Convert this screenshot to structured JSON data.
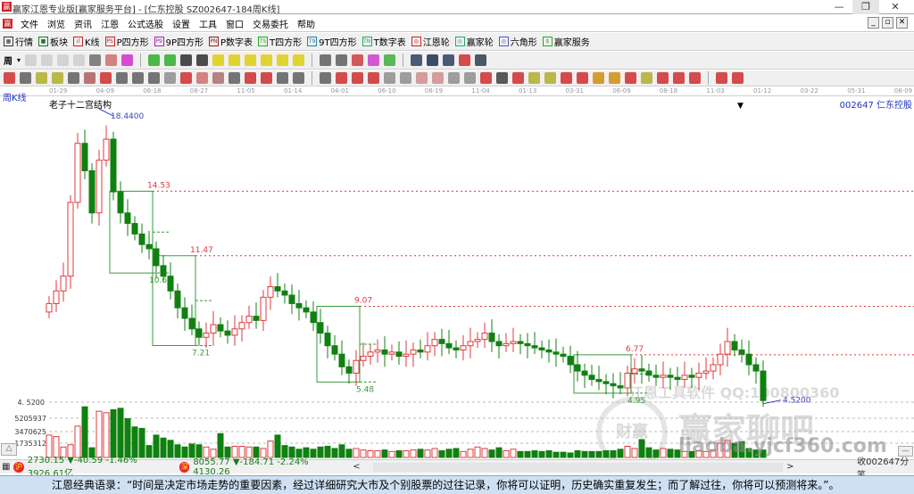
{
  "window": {
    "title": "赢家江恩专业版[赢家服务平台] - [仁东控股  SZ002647-184周K线]",
    "minimize": "—",
    "restore": "❐",
    "close": "✕",
    "logo": "赢"
  },
  "menu": {
    "items": [
      "文件",
      "浏览",
      "资讯",
      "江恩",
      "公式选股",
      "设置",
      "工具",
      "窗口",
      "交易委托",
      "帮助"
    ],
    "mdi_min": "_",
    "mdi_restore": "▫",
    "mdi_close": "✕"
  },
  "toolbar1": [
    {
      "label": "行情",
      "icon": "grid-icon",
      "glyph": "▦",
      "color": "#333"
    },
    {
      "label": "板块",
      "icon": "blocks-icon",
      "glyph": "■",
      "color": "#1a7a2a"
    },
    {
      "label": "K线",
      "icon": "kline-icon",
      "glyph": "ıl",
      "color": "#c22"
    },
    {
      "label": "P四方形",
      "icon": "p-square-icon",
      "glyph": "PS",
      "color": "#c22"
    },
    {
      "label": "9P四方形",
      "icon": "9p-square-icon",
      "glyph": "P9",
      "color": "#a2a"
    },
    {
      "label": "P数字表",
      "icon": "p-table-icon",
      "glyph": "PN",
      "color": "#822"
    },
    {
      "label": "T四方形",
      "icon": "t-square-icon",
      "glyph": "TS",
      "color": "#2a2"
    },
    {
      "label": "9T四方形",
      "icon": "9t-square-icon",
      "glyph": "T9",
      "color": "#28a"
    },
    {
      "label": "T数字表",
      "icon": "t-table-icon",
      "glyph": "TN",
      "color": "#2a6"
    },
    {
      "label": "江恩轮",
      "icon": "gann-wheel-icon",
      "glyph": "◎",
      "color": "#c22"
    },
    {
      "label": "赢家轮",
      "icon": "winner-wheel-icon",
      "glyph": "◎",
      "color": "#2a6"
    },
    {
      "label": "六角形",
      "icon": "hexagon-icon",
      "glyph": "◎",
      "color": "#55c"
    },
    {
      "label": "赢家服务",
      "icon": "dollar-icon",
      "glyph": "$",
      "color": "#2a2"
    }
  ],
  "period_selector": "周",
  "toolbar2_icons": [
    [
      "grid-ghost-icon",
      "#ccc"
    ],
    [
      "doc-ghost-icon",
      "#ccc"
    ],
    [
      "chart-ghost-icon",
      "#ccc"
    ],
    [
      "chart2-ghost-icon",
      "#ccc"
    ],
    [
      "candle-type-icon",
      "#666"
    ],
    [
      "overlay-icon",
      "#c66"
    ],
    [
      "color-flag-icon",
      "#c2c"
    ],
    "|",
    [
      "first-icon",
      "#2a2"
    ],
    [
      "last-icon",
      "#2a2"
    ],
    [
      "prev-icon",
      "#222"
    ],
    [
      "next-icon",
      "#222"
    ],
    [
      "diamond-up-icon",
      "#dc0"
    ],
    [
      "diamond-down-icon",
      "#dc0"
    ],
    [
      "diamond-left-icon",
      "#dc0"
    ],
    [
      "diamond-right-icon",
      "#dc0"
    ],
    [
      "diamond-in-icon",
      "#dc0"
    ],
    [
      "diamond-out-icon",
      "#dc0"
    ],
    "|",
    [
      "hand-icon",
      "#555"
    ],
    [
      "crosshair-icon",
      "#555"
    ],
    [
      "line-tool-icon",
      "#c33"
    ],
    [
      "gift-icon",
      "#c3c"
    ],
    [
      "calc-icon",
      "#3a3"
    ],
    "|",
    [
      "calendar-icon",
      "#235"
    ],
    [
      "calculator-icon",
      "#124"
    ],
    [
      "notes-icon",
      "#235"
    ],
    [
      "save-icon",
      "#c22"
    ],
    [
      "network-icon",
      "#234"
    ]
  ],
  "toolbar3_icons": [
    [
      "pen-icon",
      "#c22"
    ],
    [
      "parallel-icon",
      "#555"
    ],
    [
      "gann-fan-icon",
      "#aa2"
    ],
    [
      "gann-fan2-icon",
      "#aa2"
    ],
    [
      "gann-grid-icon",
      "#555"
    ],
    [
      "gann-box-icon",
      "#a55"
    ],
    [
      "pencil-red-icon",
      "#c22"
    ],
    [
      "circle-icon",
      "#555"
    ],
    [
      "lines-icon",
      "#555"
    ],
    [
      "n2-icon",
      "#555"
    ],
    [
      "pitchfork-icon",
      "#888"
    ],
    [
      "target-icon",
      "#c22"
    ],
    [
      "star-icon",
      "#c66"
    ],
    [
      "square-icon",
      "#a66"
    ],
    [
      "arc-icon",
      "#555"
    ],
    [
      "red-lines-icon",
      "#c22"
    ],
    [
      "red-box-icon",
      "#c22"
    ],
    [
      "grid2-icon",
      "#555"
    ],
    [
      "measure-icon",
      "#555"
    ],
    "|",
    [
      "rect-icon",
      "#555"
    ],
    [
      "fib-fan-icon",
      "#c22"
    ],
    [
      "fib-box-icon",
      "#c22"
    ],
    [
      "fib-box2-icon",
      "#c22"
    ],
    [
      "angle-icon",
      "#888"
    ],
    [
      "wave-icon",
      "#888"
    ],
    [
      "table-icon",
      "#c88"
    ],
    [
      "table2-icon",
      "#c88"
    ],
    [
      "lines3-icon",
      "#888"
    ],
    [
      "e-icon",
      "#888"
    ],
    [
      "fib-pct-icon",
      "#c22"
    ],
    [
      "percent-icon",
      "#333"
    ],
    [
      "pct-lines-icon",
      "#c22"
    ],
    [
      "gold-coin-icon",
      "#aa2"
    ],
    [
      "gold-lines-icon",
      "#aa2"
    ],
    [
      "flag-icon",
      "#c22"
    ],
    [
      "fib-icon",
      "#c22"
    ],
    [
      "gold-icon",
      "#c80"
    ],
    [
      "angle2-icon",
      "#c80"
    ],
    [
      "f-angle-icon",
      "#c22"
    ],
    [
      "angle3-icon",
      "#aa2"
    ],
    [
      "angle4-icon",
      "#c22"
    ],
    [
      "angle5-icon",
      "#c22"
    ],
    [
      "angle6-icon",
      "#c22"
    ],
    "|",
    [
      "yin-yang-icon",
      "#c22"
    ],
    [
      "infinity-icon",
      "#c22"
    ]
  ],
  "chart": {
    "period_label": "周K线",
    "template_name": "老子十二宫结构",
    "stock": "002647  仁东控股",
    "dates": [
      "01-29",
      "04-09",
      "06-18",
      "08-27",
      "11-05",
      "01-14",
      "04-01",
      "06-10",
      "08-19",
      "11-04",
      "01-13",
      "03-31",
      "06-09",
      "08-18",
      "11-03",
      "01-12",
      "03-22",
      "05-31",
      "08-09"
    ],
    "high_label": "18.4400",
    "low_label": "4.5200",
    "price_axis_label": "4. 5200",
    "volume_axis_labels": [
      "5205937",
      "3470625",
      "1735312"
    ],
    "colors": {
      "up": "#e0383c",
      "down": "#108010",
      "box": "#3a9a3a",
      "level": "#e0383c",
      "mark": "#4040c0"
    }
  },
  "chart_data": {
    "type": "candlestick",
    "title": "仁东控股 002647 周K线",
    "price_range": [
      4.52,
      18.44
    ],
    "volume_ticks": [
      1735312,
      3470625,
      5205937
    ],
    "close": [
      9.2,
      9.8,
      10.5,
      14.0,
      16.8,
      15.5,
      13.5,
      16.0,
      17.0,
      14.5,
      13.5,
      13.0,
      12.5,
      12.0,
      11.8,
      11.0,
      10.5,
      9.8,
      9.0,
      8.5,
      8.0,
      7.6,
      7.8,
      8.2,
      7.9,
      7.7,
      8.0,
      8.3,
      8.6,
      8.4,
      9.5,
      10.0,
      9.8,
      9.6,
      9.2,
      9.0,
      8.8,
      8.3,
      7.8,
      7.2,
      6.8,
      6.2,
      5.9,
      6.5,
      6.7,
      6.9,
      7.0,
      6.8,
      6.9,
      6.7,
      6.8,
      7.0,
      6.9,
      7.2,
      7.5,
      7.3,
      7.1,
      7.0,
      7.2,
      7.4,
      7.5,
      7.8,
      7.4,
      7.2,
      7.3,
      7.4,
      7.3,
      7.2,
      7.1,
      7.0,
      6.9,
      6.8,
      6.7,
      6.3,
      6.0,
      5.8,
      5.6,
      5.5,
      5.4,
      5.3,
      5.2,
      5.9,
      6.1,
      6.0,
      5.8,
      5.7,
      5.8,
      5.7,
      5.6,
      5.8,
      5.7,
      5.9,
      6.0,
      6.3,
      6.8,
      7.4,
      7.0,
      6.8,
      6.3,
      6.0,
      4.6
    ],
    "volume_m": [
      3.0,
      2.8,
      1.4,
      1.7,
      4.2,
      6.8,
      1.3,
      6.2,
      6.0,
      6.4,
      6.6,
      5.2,
      4.1,
      3.9,
      1.6,
      3.0,
      2.6,
      2.3,
      1.7,
      1.4,
      1.8,
      1.7,
      1.4,
      1.1,
      3.2,
      1.4,
      1.5,
      1.5,
      1.4,
      1.4,
      1.2,
      2.2,
      3.0,
      1.6,
      1.4,
      1.1,
      1.3,
      1.1,
      1.4,
      1.5,
      1.2,
      1.7,
      1.1,
      1.2,
      1.0,
      0.9,
      0.9,
      1.0,
      0.8,
      0.9,
      0.9,
      1.0,
      1.1,
      1.0,
      1.2,
      0.9,
      1.1,
      1.2,
      0.8,
      1.1,
      1.4,
      1.2,
      1.0,
      1.3,
      0.9,
      1.1,
      0.8,
      0.8,
      0.9,
      0.8,
      0.9,
      0.7,
      0.7,
      0.6,
      0.9,
      0.8,
      0.8,
      0.8,
      0.9,
      0.9,
      1.1,
      1.5,
      1.2,
      2.4,
      1.3,
      1.0,
      1.2,
      1.1,
      1.0,
      0.8,
      0.8,
      0.9,
      0.8,
      1.0,
      1.9,
      2.3,
      1.9,
      2.1,
      1.2,
      1.0,
      1.0
    ],
    "boxes": [
      {
        "top": 14.53,
        "bottom": 10.65,
        "from": 9,
        "to": 14,
        "top_label": "14.53",
        "bottom_label": "10.65"
      },
      {
        "top": 11.47,
        "bottom": 7.21,
        "from": 15,
        "to": 20,
        "top_label": "11.47",
        "bottom_label": "7.21"
      },
      {
        "top": 9.07,
        "bottom": 5.48,
        "from": 38,
        "to": 43,
        "top_label": "9.07",
        "bottom_label": "5.48"
      },
      {
        "top": 6.77,
        "bottom": 4.95,
        "from": 74,
        "to": 81,
        "top_label": "6.77",
        "bottom_label": "4.95"
      }
    ]
  },
  "watermark": {
    "line1": "江恩工具软件  QQ:100800360",
    "line2": "赢家聊吧",
    "line3": "liaoba.yjcf360.com",
    "seal": "财赢"
  },
  "status": {
    "sh_badge": "沪",
    "sh": "2730.15 ▼-40.59 -1.46% 3926.61亿",
    "sz_badge": "深",
    "sz": "8055.77 ▼-184.71 -2.24% 4130.26",
    "left_arrow": "<",
    "right_arrow": ">",
    "right_text": "收002647分笔",
    "collapse": "△",
    "minus": "—"
  },
  "quote": "江恩经典语录：“时间是决定市场走势的重要因素，经过详细研究大市及个别股票的过往记录，你将可以证明，历史确实重复发生；而了解过往，你将可以预测将来。”。"
}
